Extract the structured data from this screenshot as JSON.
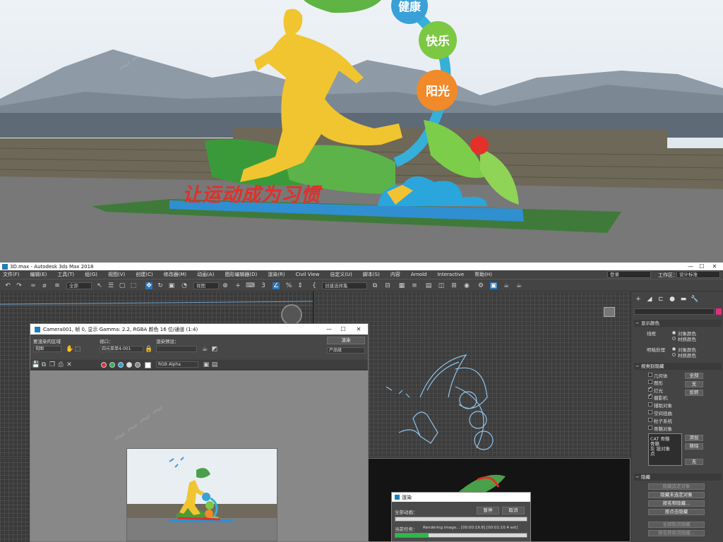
{
  "hero": {
    "bubbles": [
      "健康",
      "快乐",
      "阳光"
    ],
    "slogan": "让运动成为习惯"
  },
  "window": {
    "title": "3D.max - Autodesk 3ds Max 2018",
    "controls": [
      "—",
      "☐",
      "✕"
    ]
  },
  "menu": {
    "items": [
      "文件(F)",
      "编辑(E)",
      "工具(T)",
      "组(G)",
      "视图(V)",
      "创建(C)",
      "修改器(M)",
      "动画(A)",
      "图形编辑器(D)",
      "渲染(R)",
      "Civil View",
      "自定义(U)",
      "脚本(S)",
      "内容",
      "Arnold",
      "Interactive",
      "帮助(H)"
    ],
    "login": "登录",
    "workspace_label": "工作区：",
    "workspace_value": "设计标准"
  },
  "toolbar": {
    "filter": "全部",
    "viewcoord": "视图",
    "selection_set": "创建选择集"
  },
  "render_frame": {
    "title": "Camera001, 帧 0, 显示 Gamma: 2.2, RGBA 颜色 16 位/通道 (1:4)",
    "area_label": "要渲染的区域",
    "area_value": "视图",
    "viewport_label": "视口：",
    "viewport_value": "四元菜单4-001",
    "preset_label": "渲染预设：",
    "preset_value": "",
    "render_button": "渲染",
    "product_value": "产品级",
    "channel": "RGB Alpha"
  },
  "render_dialog": {
    "title": "渲染",
    "all_anim": "全部动画：",
    "pause": "暂停",
    "cancel": "取消",
    "current_task": "当前任务：",
    "task_text": "Rendering image...  [00:00:19.8]  [00:01:10.4 est]",
    "progress": 0.25
  },
  "command_panel": {
    "display_color_title": "显示颜色",
    "wireframe_label": "线框",
    "shaded_label": "明暗处理",
    "object_color": "对象颜色",
    "material_color": "材质颜色",
    "hide_by_category_title": "按类别隐藏",
    "categories": [
      {
        "label": "几何体",
        "checked": false
      },
      {
        "label": "图形",
        "checked": false
      },
      {
        "label": "灯光",
        "checked": true
      },
      {
        "label": "摄影机",
        "checked": true
      },
      {
        "label": "辅助对象",
        "checked": false
      },
      {
        "label": "空间扭曲",
        "checked": false
      },
      {
        "label": "粒子系统",
        "checked": false
      },
      {
        "label": "骨骼对象",
        "checked": false
      }
    ],
    "all_btn": "全部",
    "none_btn": "无",
    "invert_btn": "反转",
    "list_items": [
      "CAT 骨骼",
      "骨骼",
      "灰 链对象",
      "点"
    ],
    "add_btn": "添加",
    "remove_btn": "移除",
    "none2_btn": "无",
    "hide_title": "隐藏",
    "hide_buttons": [
      "隐藏选定对象",
      "隐藏未选定对象",
      "按名称隐藏...",
      "按点击隐藏",
      "全部取消隐藏",
      "按名称取消隐藏..."
    ]
  },
  "colors": {
    "accent_blue": "#2c73b8",
    "progress_green": "#2fb84a",
    "ui_bg": "#444444",
    "wire_blue": "#8fc3e8"
  }
}
